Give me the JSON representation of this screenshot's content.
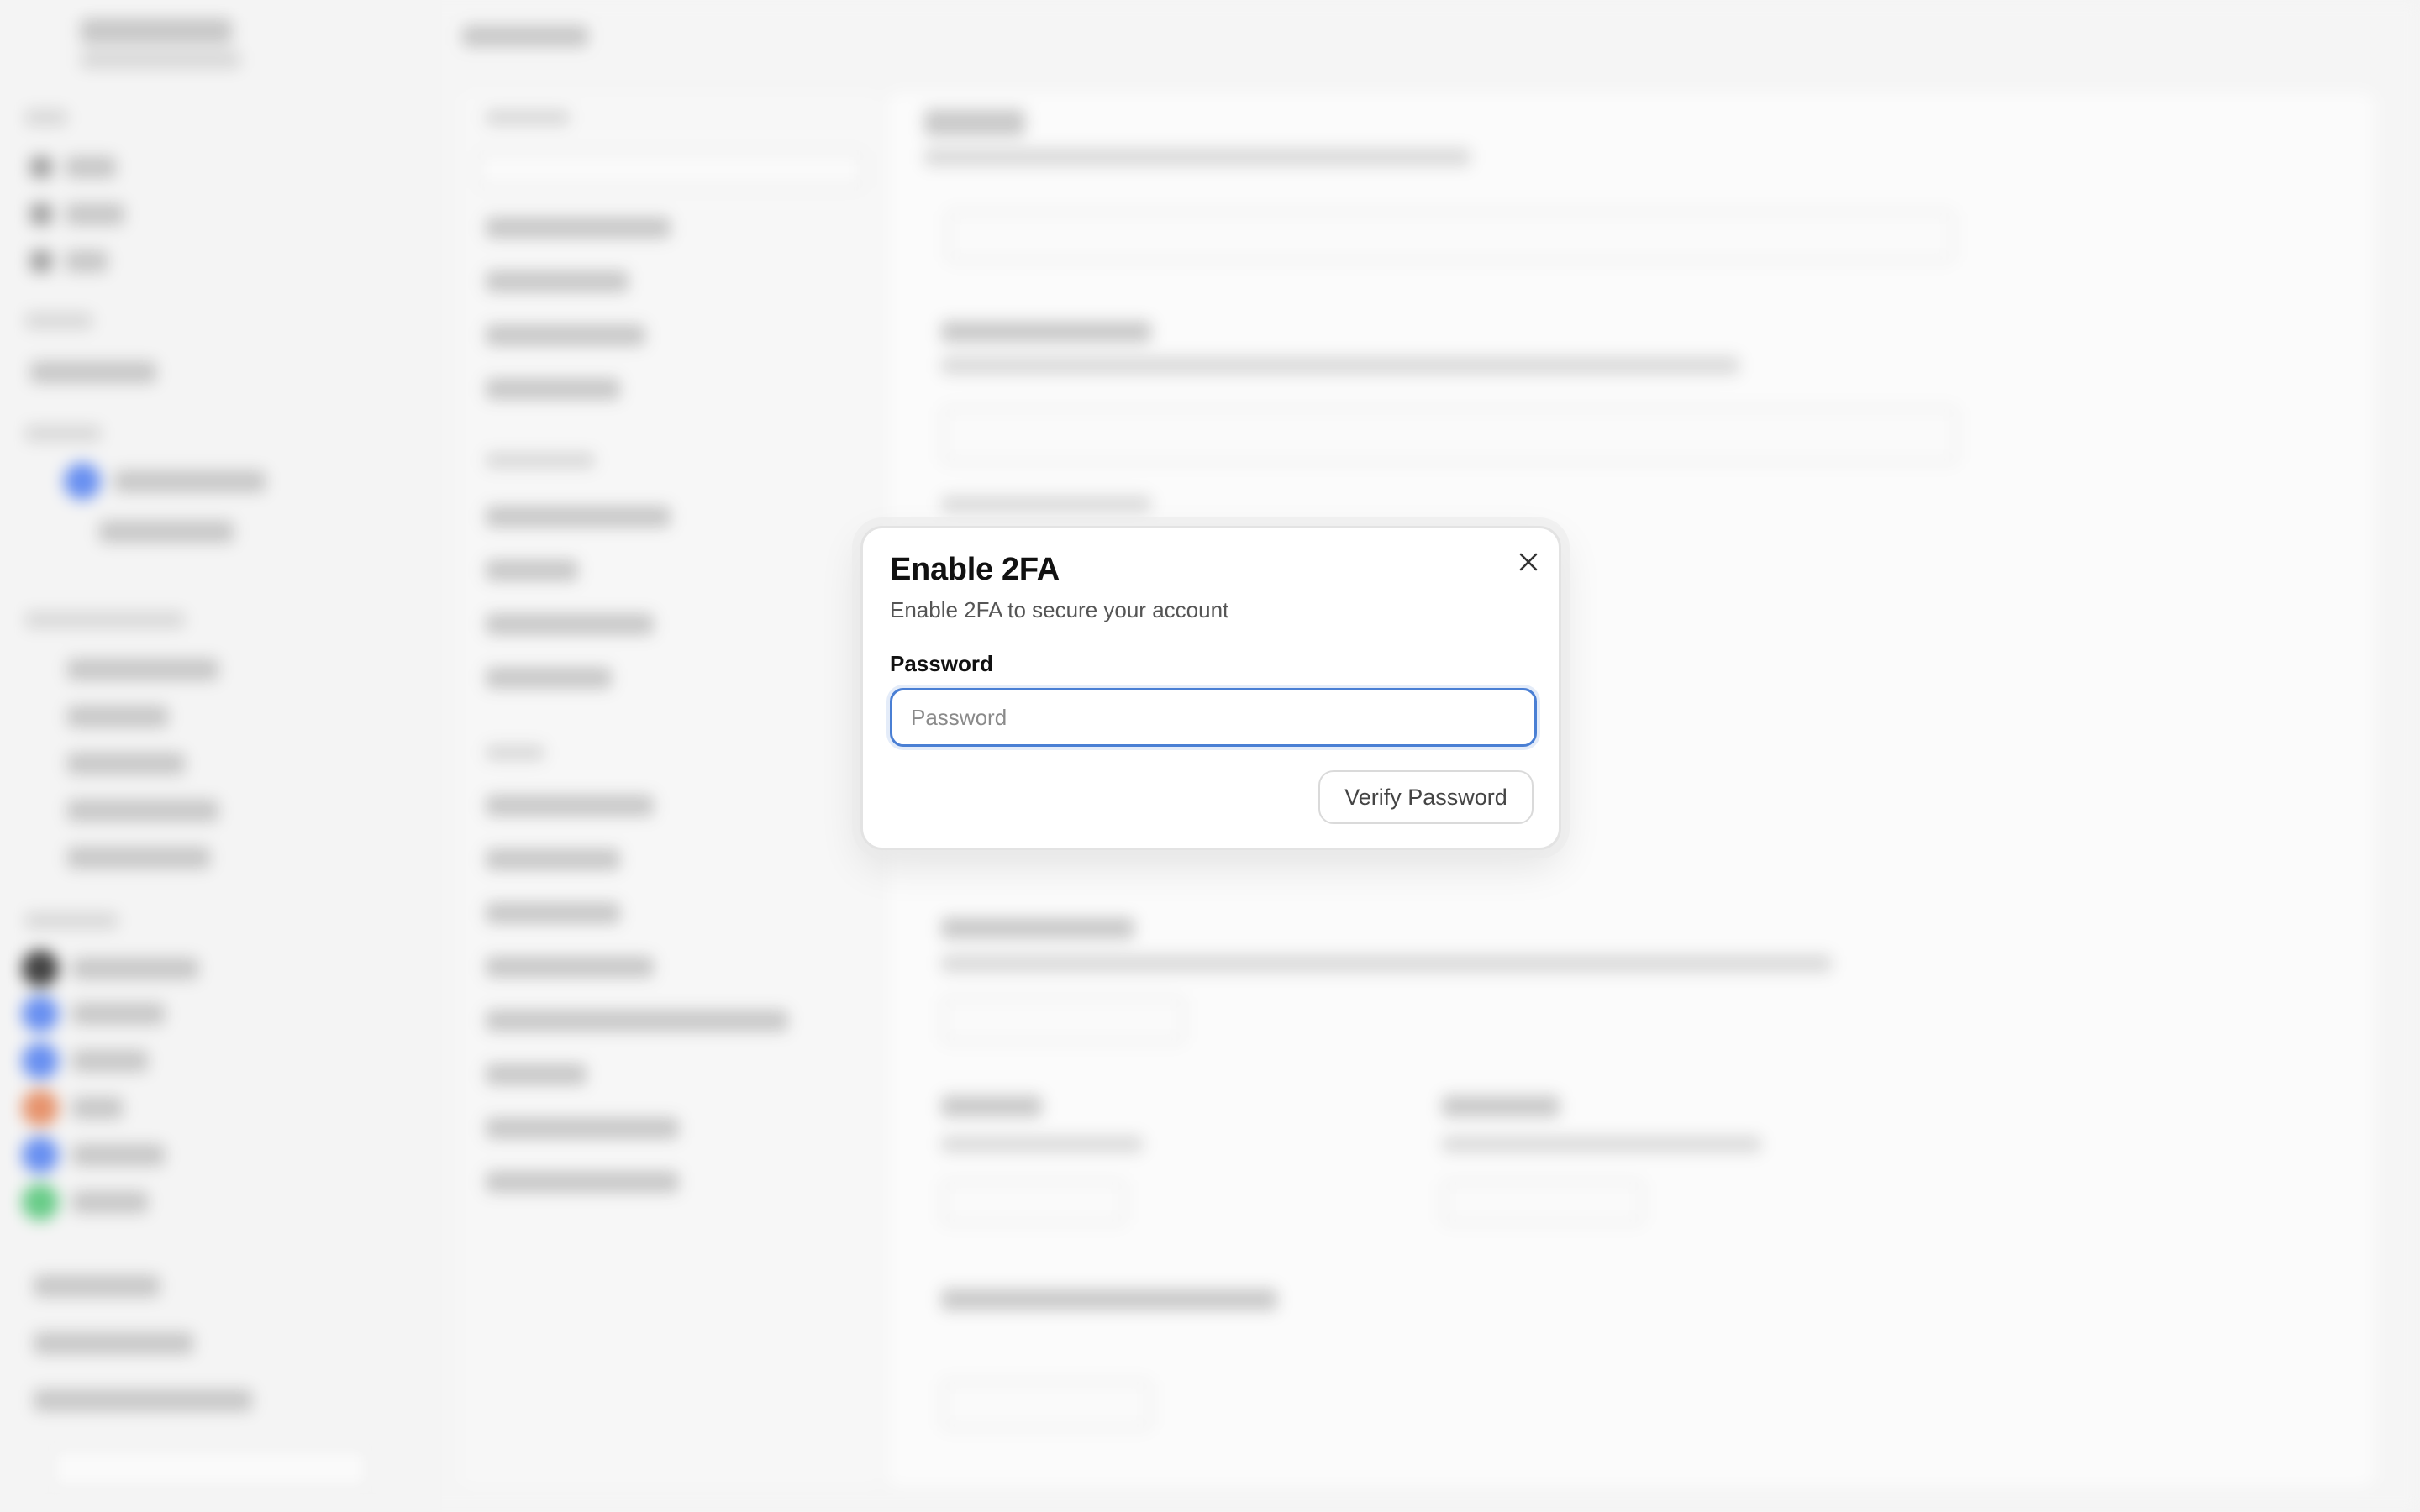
{
  "dialog": {
    "title": "Enable 2FA",
    "description": "Enable 2FA to secure your account",
    "password_label": "Password",
    "password_placeholder": "Password",
    "password_value": "",
    "verify_label": "Verify Password",
    "close_icon": "close-icon"
  },
  "colors": {
    "focus_ring": "#4a7fd4",
    "dialog_bg": "#ffffff",
    "backdrop": "#f4f4f4"
  }
}
